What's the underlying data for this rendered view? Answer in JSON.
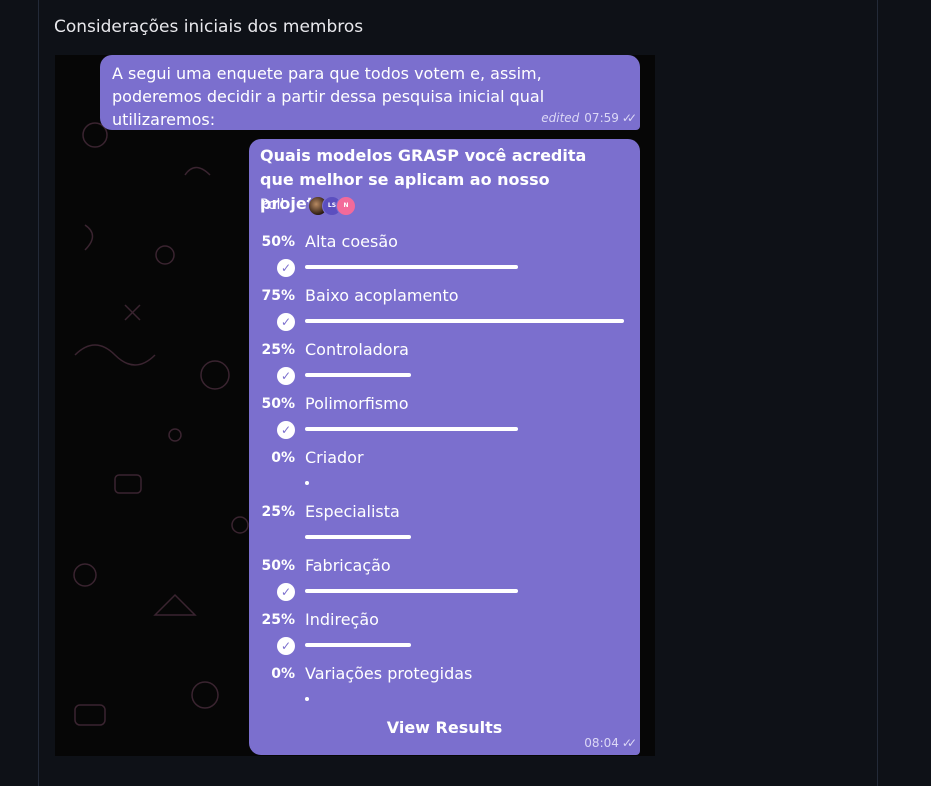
{
  "section": {
    "title": "Considerações iniciais dos membros"
  },
  "message1": {
    "text": "A segui uma enquete para que todos votem e, assim, poderemos decidir a partir dessa pesquisa inicial qual utilizaremos:",
    "edited_label": "edited",
    "time": "07:59"
  },
  "poll": {
    "question": "Quais modelos GRASP você acredita que melhor se aplicam ao nosso projeto ?",
    "type_label": "Poll",
    "voters": [
      {
        "initials": "",
        "color": "#6b4a30"
      },
      {
        "initials": "LS",
        "color": "#5b4fbf"
      },
      {
        "initials": "N",
        "color": "#f36a9a"
      }
    ],
    "options": [
      {
        "label": "Alta coesão",
        "percent_text": "50%",
        "percent": 50,
        "checked": true
      },
      {
        "label": "Baixo acoplamento",
        "percent_text": "75%",
        "percent": 75,
        "checked": true
      },
      {
        "label": "Controladora",
        "percent_text": "25%",
        "percent": 25,
        "checked": true
      },
      {
        "label": "Polimorfismo",
        "percent_text": "50%",
        "percent": 50,
        "checked": true
      },
      {
        "label": "Criador",
        "percent_text": "0%",
        "percent": 0,
        "checked": false
      },
      {
        "label": "Especialista",
        "percent_text": "25%",
        "percent": 25,
        "checked": false
      },
      {
        "label": "Fabricação",
        "percent_text": "50%",
        "percent": 50,
        "checked": true
      },
      {
        "label": "Indireção",
        "percent_text": "25%",
        "percent": 25,
        "checked": true
      },
      {
        "label": "Variações protegidas",
        "percent_text": "0%",
        "percent": 0,
        "checked": false
      }
    ],
    "view_results_label": "View Results",
    "time": "08:04"
  },
  "icons": {
    "read_receipt": "double-check-icon",
    "vote_check": "check-circle-icon"
  },
  "colors": {
    "bubble": "#7b6fce",
    "background": "#0e1117",
    "chat_bg": "#060606"
  }
}
